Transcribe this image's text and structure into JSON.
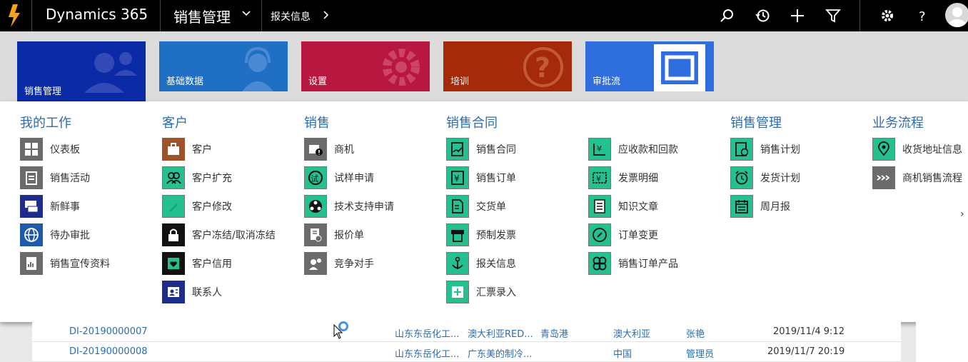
{
  "app": {
    "name": "Dynamics 365",
    "area": "销售管理",
    "breadcrumb": "报关信息"
  },
  "toolbar_icons": [
    "search-icon",
    "history-icon",
    "plus-icon",
    "filter-icon",
    "gear-icon",
    "help-icon"
  ],
  "tiles": [
    {
      "label": "销售管理",
      "color": "#0a2aa6"
    },
    {
      "label": "基础数据",
      "color": "#1f6fc5"
    },
    {
      "label": "设置",
      "color": "#b8183f"
    },
    {
      "label": "培训",
      "color": "#a52a0a"
    },
    {
      "label": "审批流",
      "color": "#2f6fdd"
    }
  ],
  "menu": {
    "columns": [
      {
        "title": "我的工作",
        "items": [
          "仪表板",
          "销售活动",
          "新鲜事",
          "待办审批",
          "销售宣传资料"
        ]
      },
      {
        "title": "客户",
        "items": [
          "客户",
          "客户扩充",
          "客户修改",
          "客户冻结/取消冻结",
          "客户信用",
          "联系人"
        ]
      },
      {
        "title": "销售",
        "items": [
          "商机",
          "试样申请",
          "技术支持申请",
          "报价单",
          "竞争对手"
        ]
      },
      {
        "title": "销售合同",
        "items": [
          "销售合同",
          "销售订单",
          "交货单",
          "预制发票",
          "报关信息",
          "汇票录入"
        ]
      },
      {
        "title": "",
        "items": [
          "应收款和回款",
          "发票明细",
          "知识文章",
          "订单变更",
          "销售订单产品"
        ]
      },
      {
        "title": "销售管理",
        "items": [
          "销售计划",
          "发货计划",
          "周月报"
        ]
      },
      {
        "title": "业务流程",
        "items": [
          "收货地址信息",
          "商机销售流程"
        ]
      }
    ]
  },
  "grid": {
    "rows": [
      {
        "id": "DI-20190000007",
        "c1": "山东东岳化工...",
        "c2": "澳大利亚RED...",
        "c3": "青岛港",
        "c4": "澳大利亚",
        "c5": "张艳",
        "date": "2019/11/4 9:12"
      },
      {
        "id": "DI-20190000008",
        "c1": "山东东岳化工...",
        "c2": "广东美的制冷...",
        "c3": "",
        "c4": "中国",
        "c5": "管理员",
        "date": "2019/11/7 20:19"
      }
    ]
  }
}
